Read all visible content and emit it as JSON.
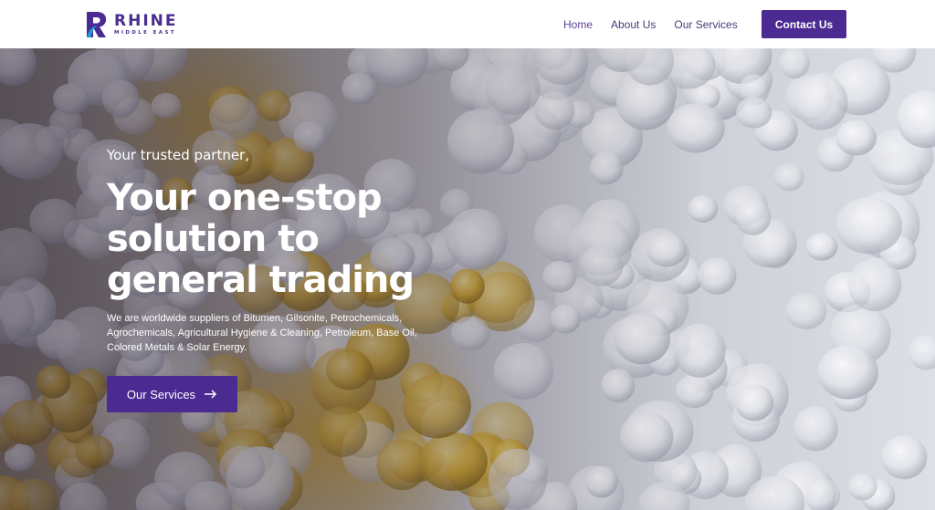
{
  "brand": {
    "name": "RHINE",
    "subtitle": "MIDDLE EAST",
    "primary_color": "#4b2a91",
    "logo_accent_color": "#1e9ad6"
  },
  "nav": {
    "items": [
      {
        "label": "Home"
      },
      {
        "label": "About Us"
      },
      {
        "label": "Our Services"
      }
    ],
    "cta_label": "Contact Us"
  },
  "hero": {
    "tagline": "Your trusted partner,",
    "headline": "Your one-stop solution to general trading",
    "description": "We are worldwide suppliers of Bitumen, Gilsonite, Petrochemicals, Agrochemicals, Agricultural Hygiene & Cleaning, Petroleum, Base Oil, Colored Metals & Solar Energy.",
    "button_label": "Our Services",
    "button_icon": "arrow-right-icon",
    "background_image": "white and amber resin pellets"
  }
}
